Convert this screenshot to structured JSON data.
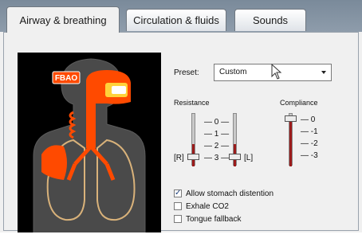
{
  "tabs": [
    {
      "label": "Airway & breathing",
      "active": true
    },
    {
      "label": "Circulation & fluids",
      "active": false
    },
    {
      "label": "Sounds",
      "active": false
    }
  ],
  "figure": {
    "badge": "FBAO"
  },
  "preset": {
    "label": "Preset:",
    "value": "Custom"
  },
  "resistance": {
    "label": "Resistance",
    "ticks": [
      "0",
      "1",
      "2",
      "3"
    ],
    "left_label": "[R]",
    "right_label": "[L]",
    "left_value": 3,
    "right_value": 3
  },
  "compliance": {
    "label": "Compliance",
    "ticks": [
      "0",
      "-1",
      "-2",
      "-3"
    ],
    "value": 0
  },
  "options": [
    {
      "label": "Allow stomach distention",
      "checked": true
    },
    {
      "label": "Exhale CO2",
      "checked": false
    },
    {
      "label": "Tongue fallback",
      "checked": false
    }
  ],
  "colors": {
    "airway": "#ff4a00",
    "face_accent": "#ffd23a",
    "slider_fill": "#9b1b1b"
  }
}
